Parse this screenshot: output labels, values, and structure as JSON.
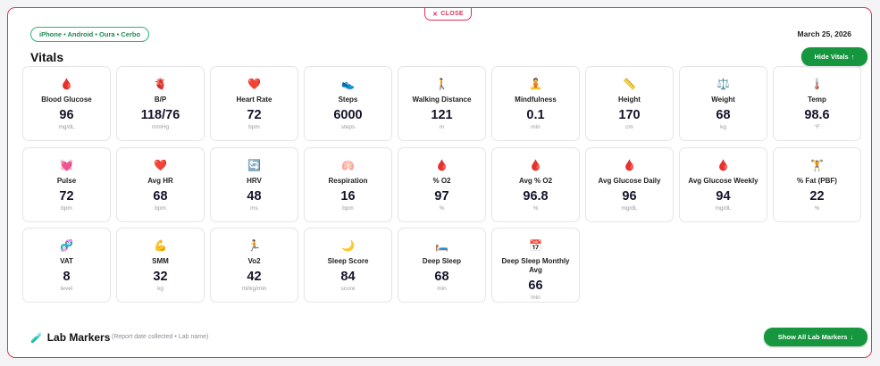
{
  "close_label": "CLOSE",
  "devices": "iPhone • Android • Oura • Cerbo",
  "date": "March 25, 2026",
  "section_title": "Vitals",
  "hide_button": "Hide Vitals",
  "lab": {
    "title": "Lab Markers",
    "subtitle": "(Report date collected • Lab name)",
    "button": "Show All Lab Markers"
  },
  "vitals": [
    {
      "icon": "🩸",
      "label": "Blood Glucose",
      "value": "96",
      "unit": "mg/dL"
    },
    {
      "icon": "🫀",
      "label": "B/P",
      "value": "118/76",
      "unit": "mmHg"
    },
    {
      "icon": "❤️",
      "label": "Heart Rate",
      "value": "72",
      "unit": "bpm"
    },
    {
      "icon": "👟",
      "label": "Steps",
      "value": "6000",
      "unit": "steps"
    },
    {
      "icon": "🚶",
      "label": "Walking Distance",
      "value": "121",
      "unit": "m"
    },
    {
      "icon": "🧘",
      "label": "Mindfulness",
      "value": "0.1",
      "unit": "min"
    },
    {
      "icon": "📏",
      "label": "Height",
      "value": "170",
      "unit": "cm"
    },
    {
      "icon": "⚖️",
      "label": "Weight",
      "value": "68",
      "unit": "kg"
    },
    {
      "icon": "🌡️",
      "label": "Temp",
      "value": "98.6",
      "unit": "°F"
    },
    {
      "icon": "💓",
      "label": "Pulse",
      "value": "72",
      "unit": "bpm"
    },
    {
      "icon": "❤️",
      "label": "Avg HR",
      "value": "68",
      "unit": "bpm"
    },
    {
      "icon": "🔄",
      "label": "HRV",
      "value": "48",
      "unit": "ms"
    },
    {
      "icon": "🫁",
      "label": "Respiration",
      "value": "16",
      "unit": "bpm"
    },
    {
      "icon": "🩸",
      "label": "% O2",
      "value": "97",
      "unit": "%"
    },
    {
      "icon": "🩸",
      "label": "Avg % O2",
      "value": "96.8",
      "unit": "%"
    },
    {
      "icon": "🩸",
      "label": "Avg Glucose Daily",
      "value": "96",
      "unit": "mg/dL"
    },
    {
      "icon": "🩸",
      "label": "Avg Glucose Weekly",
      "value": "94",
      "unit": "mg/dL"
    },
    {
      "icon": "🏋️",
      "label": "% Fat (PBF)",
      "value": "22",
      "unit": "%"
    },
    {
      "icon": "🧬",
      "label": "VAT",
      "value": "8",
      "unit": "level"
    },
    {
      "icon": "💪",
      "label": "SMM",
      "value": "32",
      "unit": "kg"
    },
    {
      "icon": "🏃",
      "label": "Vo2",
      "value": "42",
      "unit": "ml/kg/min"
    },
    {
      "icon": "🌙",
      "label": "Sleep Score",
      "value": "84",
      "unit": "score"
    },
    {
      "icon": "🛏️",
      "label": "Deep Sleep",
      "value": "68",
      "unit": "min"
    },
    {
      "icon": "📅",
      "label": "Deep Sleep Monthly Avg",
      "value": "66",
      "unit": "min"
    }
  ]
}
